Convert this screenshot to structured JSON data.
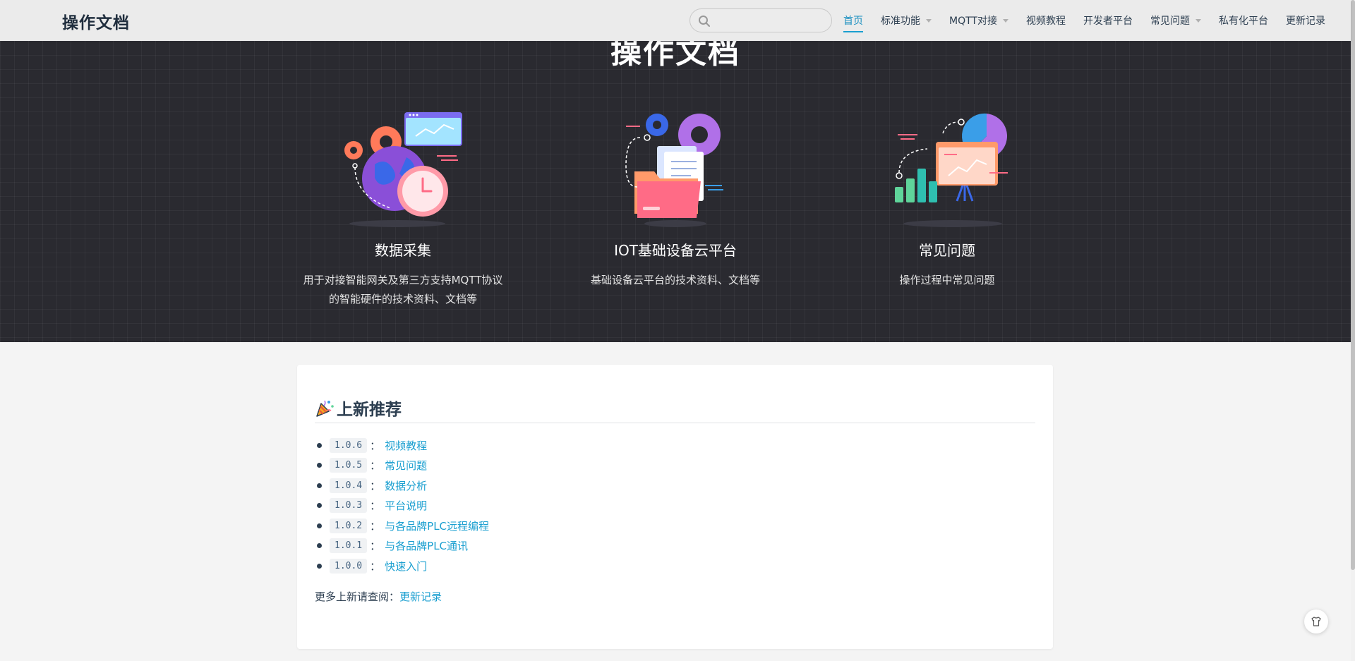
{
  "site": {
    "title": "操作文档"
  },
  "search": {
    "placeholder": "",
    "icon": "search-icon"
  },
  "nav": {
    "items": [
      {
        "label": "首页",
        "active": true,
        "dropdown": false
      },
      {
        "label": "标准功能",
        "active": false,
        "dropdown": true
      },
      {
        "label": "MQTT对接",
        "active": false,
        "dropdown": true
      },
      {
        "label": "视频教程",
        "active": false,
        "dropdown": false
      },
      {
        "label": "开发者平台",
        "active": false,
        "dropdown": false
      },
      {
        "label": "常见问题",
        "active": false,
        "dropdown": true
      },
      {
        "label": "私有化平台",
        "active": false,
        "dropdown": false
      },
      {
        "label": "更新记录",
        "active": false,
        "dropdown": false
      }
    ]
  },
  "hero": {
    "title": "操作文档",
    "features": [
      {
        "title": "数据采集",
        "desc_line1": "用于对接智能网关及第三方支持MQTT协议",
        "desc_line2": "的智能硬件的技术资料、文档等",
        "icon": "data-collection-illustration"
      },
      {
        "title": "IOT基础设备云平台",
        "desc_line1": "基础设备云平台的技术资料、文档等",
        "desc_line2": "",
        "icon": "iot-platform-illustration"
      },
      {
        "title": "常见问题",
        "desc_line1": "操作过程中常见问题",
        "desc_line2": "",
        "icon": "faq-illustration"
      }
    ]
  },
  "releases": {
    "heading": "上新推荐",
    "items": [
      {
        "version": "1.0.6",
        "link": "视频教程"
      },
      {
        "version": "1.0.5",
        "link": "常见问题"
      },
      {
        "version": "1.0.4",
        "link": "数据分析"
      },
      {
        "version": "1.0.3",
        "link": "平台说明"
      },
      {
        "version": "1.0.2",
        "link": "与各品牌PLC远程编程"
      },
      {
        "version": "1.0.1",
        "link": "与各品牌PLC通讯"
      },
      {
        "version": "1.0.0",
        "link": "快速入门"
      }
    ],
    "separator": "：",
    "more_prefix": "更多上新请查阅：",
    "more_link": "更新记录"
  },
  "colors": {
    "accent": "#1a9fd0",
    "hero_bg": "#2a2a30",
    "text": "#2c3e50"
  }
}
